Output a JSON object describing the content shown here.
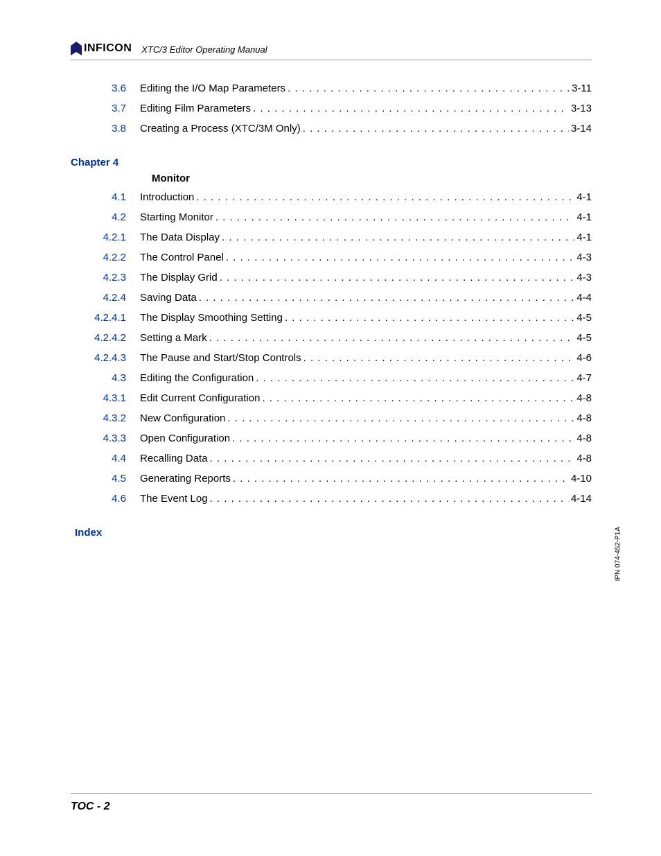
{
  "brand": "INFICON",
  "doc_title": "XTC/3 Editor Operating Manual",
  "side_mark": "IPN 074-452-P1A",
  "footer": "TOC - 2",
  "pre_entries": [
    {
      "num": "3.6",
      "title": "Editing the I/O Map Parameters",
      "page": "3-11"
    },
    {
      "num": "3.7",
      "title": "Editing Film Parameters",
      "page": "3-13"
    },
    {
      "num": "3.8",
      "title": "Creating a Process (XTC/3M Only)",
      "page": "3-14"
    }
  ],
  "chapter": {
    "label": "Chapter 4",
    "title": "Monitor"
  },
  "entries": [
    {
      "num": "4.1",
      "title": "Introduction",
      "page": "4-1"
    },
    {
      "num": "4.2",
      "title": "Starting Monitor",
      "page": "4-1"
    },
    {
      "num": "4.2.1",
      "title": "The Data Display",
      "page": "4-1"
    },
    {
      "num": "4.2.2",
      "title": "The Control Panel",
      "page": "4-3"
    },
    {
      "num": "4.2.3",
      "title": "The Display Grid",
      "page": "4-3"
    },
    {
      "num": "4.2.4",
      "title": "Saving Data",
      "page": "4-4"
    },
    {
      "num": "4.2.4.1",
      "title": "The Display Smoothing Setting",
      "page": "4-5"
    },
    {
      "num": "4.2.4.2",
      "title": "Setting a Mark",
      "page": "4-5"
    },
    {
      "num": "4.2.4.3",
      "title": "The Pause and Start/Stop Controls",
      "page": "4-6"
    },
    {
      "num": "4.3",
      "title": "Editing the Configuration",
      "page": "4-7"
    },
    {
      "num": "4.3.1",
      "title": "Edit Current Configuration",
      "page": "4-8"
    },
    {
      "num": "4.3.2",
      "title": "New Configuration",
      "page": "4-8"
    },
    {
      "num": "4.3.3",
      "title": "Open Configuration",
      "page": "4-8"
    },
    {
      "num": "4.4",
      "title": "Recalling Data",
      "page": "4-8"
    },
    {
      "num": "4.5",
      "title": "Generating Reports",
      "page": "4-10"
    },
    {
      "num": "4.6",
      "title": "The Event Log",
      "page": "4-14"
    }
  ],
  "index_label": "Index"
}
